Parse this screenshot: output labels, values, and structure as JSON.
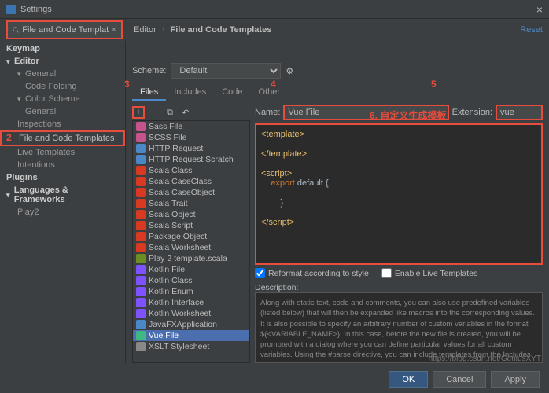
{
  "window": {
    "title": "Settings"
  },
  "search": {
    "value": "File and Code Templates"
  },
  "breadcrumb": {
    "root": "Editor",
    "leaf": "File and Code Templates"
  },
  "reset_label": "Reset",
  "sidebar": {
    "keymap": "Keymap",
    "editor": "Editor",
    "general": "General",
    "codefolding": "Code Folding",
    "colorscheme": "Color Scheme",
    "cs_general": "General",
    "inspections": "Inspections",
    "fct": "File and Code Templates",
    "livetpl": "Live Templates",
    "intentions": "Intentions",
    "plugins": "Plugins",
    "langs": "Languages & Frameworks",
    "play2": "Play2"
  },
  "scheme": {
    "label": "Scheme:",
    "value": "Default"
  },
  "tabs": [
    "Files",
    "Includes",
    "Code",
    "Other"
  ],
  "filelist": [
    {
      "label": "Sass File",
      "color": "#c6538c"
    },
    {
      "label": "SCSS File",
      "color": "#c6538c"
    },
    {
      "label": "HTTP Request",
      "color": "#4a88c7"
    },
    {
      "label": "HTTP Request Scratch",
      "color": "#4a88c7"
    },
    {
      "label": "Scala Class",
      "color": "#d73a20"
    },
    {
      "label": "Scala CaseClass",
      "color": "#d73a20"
    },
    {
      "label": "Scala CaseObject",
      "color": "#d73a20"
    },
    {
      "label": "Scala Trait",
      "color": "#d73a20"
    },
    {
      "label": "Scala Object",
      "color": "#d73a20"
    },
    {
      "label": "Scala Script",
      "color": "#d73a20"
    },
    {
      "label": "Package Object",
      "color": "#d73a20"
    },
    {
      "label": "Scala Worksheet",
      "color": "#d73a20"
    },
    {
      "label": "Play 2 template.scala",
      "color": "#6b8e23"
    },
    {
      "label": "Kotlin File",
      "color": "#7f52ff"
    },
    {
      "label": "Kotlin Class",
      "color": "#7f52ff"
    },
    {
      "label": "Kotlin Enum",
      "color": "#7f52ff"
    },
    {
      "label": "Kotlin Interface",
      "color": "#7f52ff"
    },
    {
      "label": "Kotlin Worksheet",
      "color": "#7f52ff"
    },
    {
      "label": "JavaFXApplication",
      "color": "#4a88c7"
    },
    {
      "label": "Vue File",
      "color": "#41b883",
      "sel": true
    },
    {
      "label": "XSLT Stylesheet",
      "color": "#888"
    }
  ],
  "form": {
    "name_label": "Name:",
    "name_value": "Vue File",
    "ext_label": "Extension:",
    "ext_value": "vue",
    "reformat": "Reformat according to style",
    "enable_live": "Enable Live Templates",
    "desc_label": "Description:"
  },
  "editor_code": {
    "l1a": "<template>",
    "l2a": "</template>",
    "l3a": "<script>",
    "l3b": "export",
    "l3c": " default {",
    "l4": "}",
    "l5": "</script>"
  },
  "description": "Along with static text, code and comments, you can also use predefined variables (listed below) that will then be expanded like macros into the corresponding values. It is also possible to specify an arbitrary number of custom variables in the format ${<VARIABLE_NAME>}. In this case, before the new file is created, you will be prompted with a dialog where you can define particular values for all custom variables.\nUsing the #parse directive, you can include templates from the Includes tab, by specifying the full name of the desired template as a parameter in quotation marks.\nFor example:\n#parse(\"File Header.java\")",
  "buttons": {
    "ok": "OK",
    "cancel": "Cancel",
    "apply": "Apply"
  },
  "annotations": {
    "n2": "2",
    "n3": "3",
    "n4": "4",
    "n5": "5",
    "n6": "6. 自定义生成模板"
  },
  "watermark": "https://blog.csdn.net/GeniusXYT"
}
